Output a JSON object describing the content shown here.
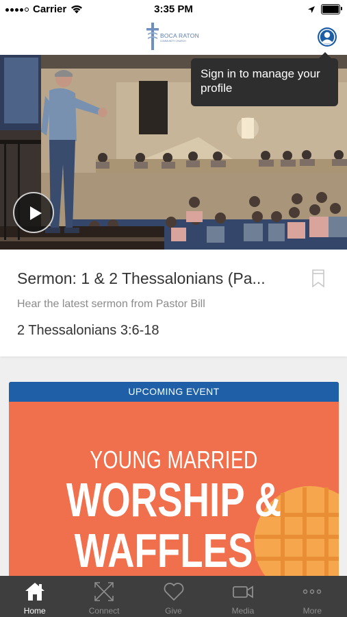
{
  "status_bar": {
    "carrier": "Carrier",
    "time": "3:35 PM"
  },
  "header": {
    "logo_title": "BOCA RATON",
    "logo_subtitle": "COMMUNITY CHURCH"
  },
  "tooltip": {
    "text": "Sign in to manage your profile"
  },
  "sermon": {
    "title": "Sermon: 1 & 2 Thessalonians (Pa...",
    "subtitle": "Hear the latest sermon from Pastor Bill",
    "passage": "2 Thessalonians 3:6-18"
  },
  "event": {
    "banner": "UPCOMING EVENT",
    "eyebrow": "YOUNG MARRIED",
    "headline_line1": "WORSHIP &",
    "headline_line2": "WAFFLES"
  },
  "tabs": [
    {
      "label": "Home",
      "icon": "home-icon",
      "active": true
    },
    {
      "label": "Connect",
      "icon": "connect-icon",
      "active": false
    },
    {
      "label": "Give",
      "icon": "heart-icon",
      "active": false
    },
    {
      "label": "Media",
      "icon": "video-icon",
      "active": false
    },
    {
      "label": "More",
      "icon": "more-icon",
      "active": false
    }
  ],
  "colors": {
    "brand_blue": "#1f5fa7",
    "event_orange": "#f06f4c",
    "tab_bar": "#3e3e3e",
    "tooltip_bg": "#2e2e2e"
  }
}
